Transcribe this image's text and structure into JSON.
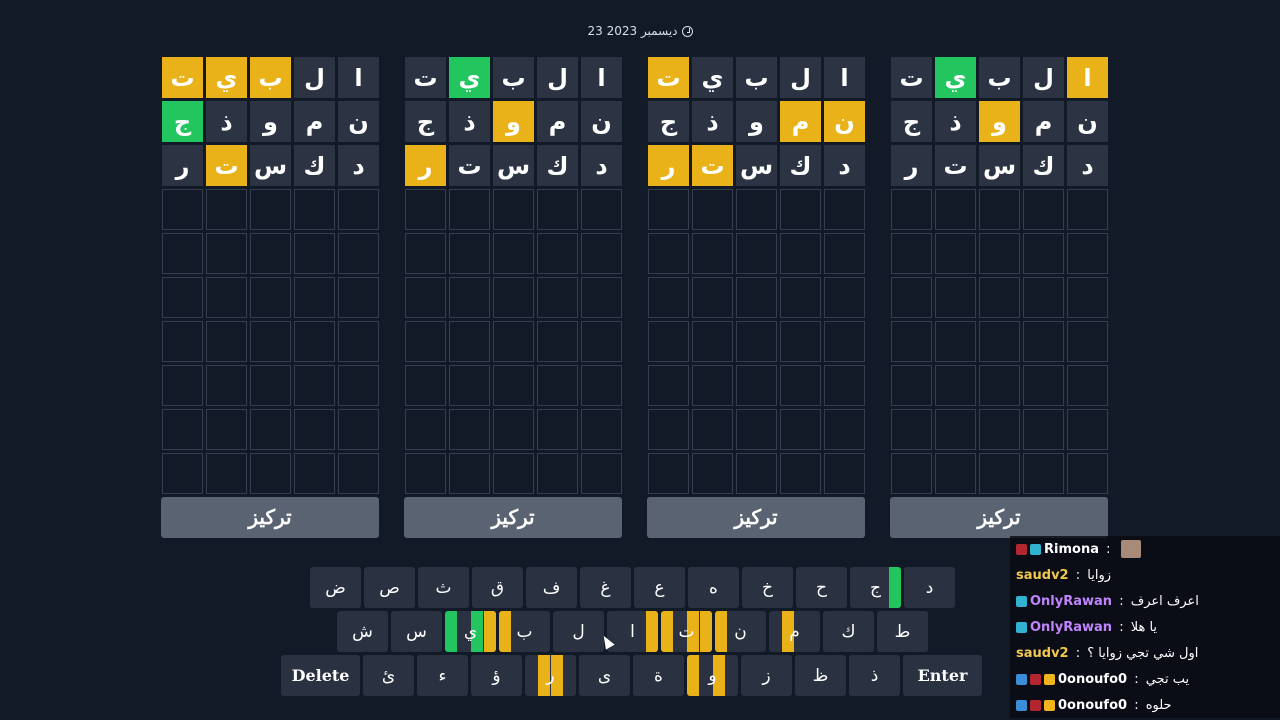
{
  "date": "23 ديسمبر 2023",
  "boards": [
    {
      "rows": [
        [
          "ا",
          "ل",
          "ب",
          "ي",
          "ت"
        ],
        [
          "ن",
          "م",
          "و",
          "ذ",
          "ج"
        ],
        [
          "د",
          "ك",
          "س",
          "ت",
          "ر"
        ],
        [
          "",
          "",
          "",
          "",
          ""
        ],
        [
          "",
          "",
          "",
          "",
          ""
        ],
        [
          "",
          "",
          "",
          "",
          ""
        ],
        [
          "",
          "",
          "",
          "",
          ""
        ],
        [
          "",
          "",
          "",
          "",
          ""
        ],
        [
          "",
          "",
          "",
          "",
          ""
        ],
        [
          "",
          "",
          "",
          "",
          ""
        ]
      ],
      "states": [
        [
          "b",
          "b",
          "y",
          "y",
          "y"
        ],
        [
          "b",
          "b",
          "b",
          "b",
          "g"
        ],
        [
          "b",
          "b",
          "b",
          "y",
          "b"
        ],
        [
          "e",
          "e",
          "e",
          "e",
          "e"
        ],
        [
          "e",
          "e",
          "e",
          "e",
          "e"
        ],
        [
          "e",
          "e",
          "e",
          "e",
          "e"
        ],
        [
          "e",
          "e",
          "e",
          "e",
          "e"
        ],
        [
          "e",
          "e",
          "e",
          "e",
          "e"
        ],
        [
          "e",
          "e",
          "e",
          "e",
          "e"
        ],
        [
          "e",
          "e",
          "e",
          "e",
          "e"
        ]
      ],
      "focus_label": "تركيز"
    },
    {
      "rows": [
        [
          "ا",
          "ل",
          "ب",
          "ي",
          "ت"
        ],
        [
          "ن",
          "م",
          "و",
          "ذ",
          "ج"
        ],
        [
          "د",
          "ك",
          "س",
          "ت",
          "ر"
        ],
        [
          "",
          "",
          "",
          "",
          ""
        ],
        [
          "",
          "",
          "",
          "",
          ""
        ],
        [
          "",
          "",
          "",
          "",
          ""
        ],
        [
          "",
          "",
          "",
          "",
          ""
        ],
        [
          "",
          "",
          "",
          "",
          ""
        ],
        [
          "",
          "",
          "",
          "",
          ""
        ],
        [
          "",
          "",
          "",
          "",
          ""
        ]
      ],
      "states": [
        [
          "b",
          "b",
          "b",
          "g",
          "b"
        ],
        [
          "b",
          "b",
          "y",
          "b",
          "b"
        ],
        [
          "b",
          "b",
          "b",
          "b",
          "y"
        ],
        [
          "e",
          "e",
          "e",
          "e",
          "e"
        ],
        [
          "e",
          "e",
          "e",
          "e",
          "e"
        ],
        [
          "e",
          "e",
          "e",
          "e",
          "e"
        ],
        [
          "e",
          "e",
          "e",
          "e",
          "e"
        ],
        [
          "e",
          "e",
          "e",
          "e",
          "e"
        ],
        [
          "e",
          "e",
          "e",
          "e",
          "e"
        ],
        [
          "e",
          "e",
          "e",
          "e",
          "e"
        ]
      ],
      "focus_label": "تركيز"
    },
    {
      "rows": [
        [
          "ا",
          "ل",
          "ب",
          "ي",
          "ت"
        ],
        [
          "ن",
          "م",
          "و",
          "ذ",
          "ج"
        ],
        [
          "د",
          "ك",
          "س",
          "ت",
          "ر"
        ],
        [
          "",
          "",
          "",
          "",
          ""
        ],
        [
          "",
          "",
          "",
          "",
          ""
        ],
        [
          "",
          "",
          "",
          "",
          ""
        ],
        [
          "",
          "",
          "",
          "",
          ""
        ],
        [
          "",
          "",
          "",
          "",
          ""
        ],
        [
          "",
          "",
          "",
          "",
          ""
        ],
        [
          "",
          "",
          "",
          "",
          ""
        ]
      ],
      "states": [
        [
          "b",
          "b",
          "b",
          "b",
          "y"
        ],
        [
          "y",
          "y",
          "b",
          "b",
          "b"
        ],
        [
          "b",
          "b",
          "b",
          "y",
          "y"
        ],
        [
          "e",
          "e",
          "e",
          "e",
          "e"
        ],
        [
          "e",
          "e",
          "e",
          "e",
          "e"
        ],
        [
          "e",
          "e",
          "e",
          "e",
          "e"
        ],
        [
          "e",
          "e",
          "e",
          "e",
          "e"
        ],
        [
          "e",
          "e",
          "e",
          "e",
          "e"
        ],
        [
          "e",
          "e",
          "e",
          "e",
          "e"
        ],
        [
          "e",
          "e",
          "e",
          "e",
          "e"
        ]
      ],
      "focus_label": "تركيز"
    },
    {
      "rows": [
        [
          "ا",
          "ل",
          "ب",
          "ي",
          "ت"
        ],
        [
          "ن",
          "م",
          "و",
          "ذ",
          "ج"
        ],
        [
          "د",
          "ك",
          "س",
          "ت",
          "ر"
        ],
        [
          "",
          "",
          "",
          "",
          ""
        ],
        [
          "",
          "",
          "",
          "",
          ""
        ],
        [
          "",
          "",
          "",
          "",
          ""
        ],
        [
          "",
          "",
          "",
          "",
          ""
        ],
        [
          "",
          "",
          "",
          "",
          ""
        ],
        [
          "",
          "",
          "",
          "",
          ""
        ],
        [
          "",
          "",
          "",
          "",
          ""
        ]
      ],
      "states": [
        [
          "y",
          "b",
          "b",
          "g",
          "b"
        ],
        [
          "b",
          "b",
          "y",
          "b",
          "b"
        ],
        [
          "b",
          "b",
          "b",
          "b",
          "b"
        ],
        [
          "e",
          "e",
          "e",
          "e",
          "e"
        ],
        [
          "e",
          "e",
          "e",
          "e",
          "e"
        ],
        [
          "e",
          "e",
          "e",
          "e",
          "e"
        ],
        [
          "e",
          "e",
          "e",
          "e",
          "e"
        ],
        [
          "e",
          "e",
          "e",
          "e",
          "e"
        ],
        [
          "e",
          "e",
          "e",
          "e",
          "e"
        ],
        [
          "e",
          "e",
          "e",
          "e",
          "e"
        ]
      ],
      "focus_label": "تركيز"
    }
  ],
  "keyboard": {
    "rows": [
      [
        {
          "label": "د",
          "stripes": []
        },
        {
          "label": "ج",
          "stripes": [
            "",
            "",
            "",
            "g"
          ]
        },
        {
          "label": "ح",
          "stripes": []
        },
        {
          "label": "خ",
          "stripes": []
        },
        {
          "label": "ه",
          "stripes": []
        },
        {
          "label": "ع",
          "stripes": []
        },
        {
          "label": "غ",
          "stripes": []
        },
        {
          "label": "ف",
          "stripes": []
        },
        {
          "label": "ق",
          "stripes": []
        },
        {
          "label": "ث",
          "stripes": []
        },
        {
          "label": "ص",
          "stripes": []
        },
        {
          "label": "ض",
          "stripes": []
        }
      ],
      [
        {
          "label": "ط",
          "stripes": []
        },
        {
          "label": "ك",
          "stripes": []
        },
        {
          "label": "م",
          "stripes": [
            "",
            "y",
            "",
            ""
          ]
        },
        {
          "label": "ن",
          "stripes": [
            "y",
            "",
            "",
            ""
          ]
        },
        {
          "label": "ت",
          "stripes": [
            "y",
            "",
            "y",
            "y"
          ]
        },
        {
          "label": "ا",
          "stripes": [
            "",
            "",
            "",
            "y"
          ]
        },
        {
          "label": "ل",
          "stripes": []
        },
        {
          "label": "ب",
          "stripes": [
            "y",
            "",
            "",
            ""
          ]
        },
        {
          "label": "ي",
          "stripes": [
            "g",
            "",
            "g",
            "y"
          ]
        },
        {
          "label": "س",
          "stripes": []
        },
        {
          "label": "ش",
          "stripes": []
        }
      ],
      [
        {
          "label": "Enter",
          "wide": true,
          "stripes": []
        },
        {
          "label": "ذ",
          "stripes": []
        },
        {
          "label": "ظ",
          "stripes": []
        },
        {
          "label": "ز",
          "stripes": []
        },
        {
          "label": "و",
          "stripes": [
            "y",
            "",
            "y",
            ""
          ]
        },
        {
          "label": "ة",
          "stripes": []
        },
        {
          "label": "ى",
          "stripes": []
        },
        {
          "label": "ر",
          "stripes": [
            "",
            "y",
            "y",
            ""
          ]
        },
        {
          "label": "ؤ",
          "stripes": []
        },
        {
          "label": "ء",
          "stripes": []
        },
        {
          "label": "ئ",
          "stripes": []
        },
        {
          "label": "Delete",
          "wide": true,
          "stripes": []
        }
      ]
    ]
  },
  "chat": [
    {
      "badges": [
        "red",
        "cyan"
      ],
      "user": "Rimona",
      "user_color": "#ffffff",
      "sep": " : ",
      "message": "",
      "avatar": true
    },
    {
      "badges": [],
      "user": "saudv2",
      "user_color": "#f2c94c",
      "sep": " : ",
      "message": "زوايا"
    },
    {
      "badges": [
        "cyan"
      ],
      "user": "OnlyRawan",
      "user_color": "#c084fc",
      "sep": " : ",
      "message": "اعرف اعرف"
    },
    {
      "badges": [
        "cyan"
      ],
      "user": "OnlyRawan",
      "user_color": "#c084fc",
      "sep": " : ",
      "message": "يا هلا"
    },
    {
      "badges": [],
      "user": "saudv2",
      "user_color": "#f2c94c",
      "sep": " : ",
      "message": "اول شي تجي زوايا ؟"
    },
    {
      "badges": [
        "blue",
        "red",
        "yel"
      ],
      "user": "0onoufo0",
      "user_color": "#ffffff",
      "sep": " : ",
      "message": "يب تجي"
    },
    {
      "badges": [
        "blue",
        "red",
        "yel"
      ],
      "user": "0onoufo0",
      "user_color": "#ffffff",
      "sep": " : ",
      "message": "حلوه"
    }
  ]
}
